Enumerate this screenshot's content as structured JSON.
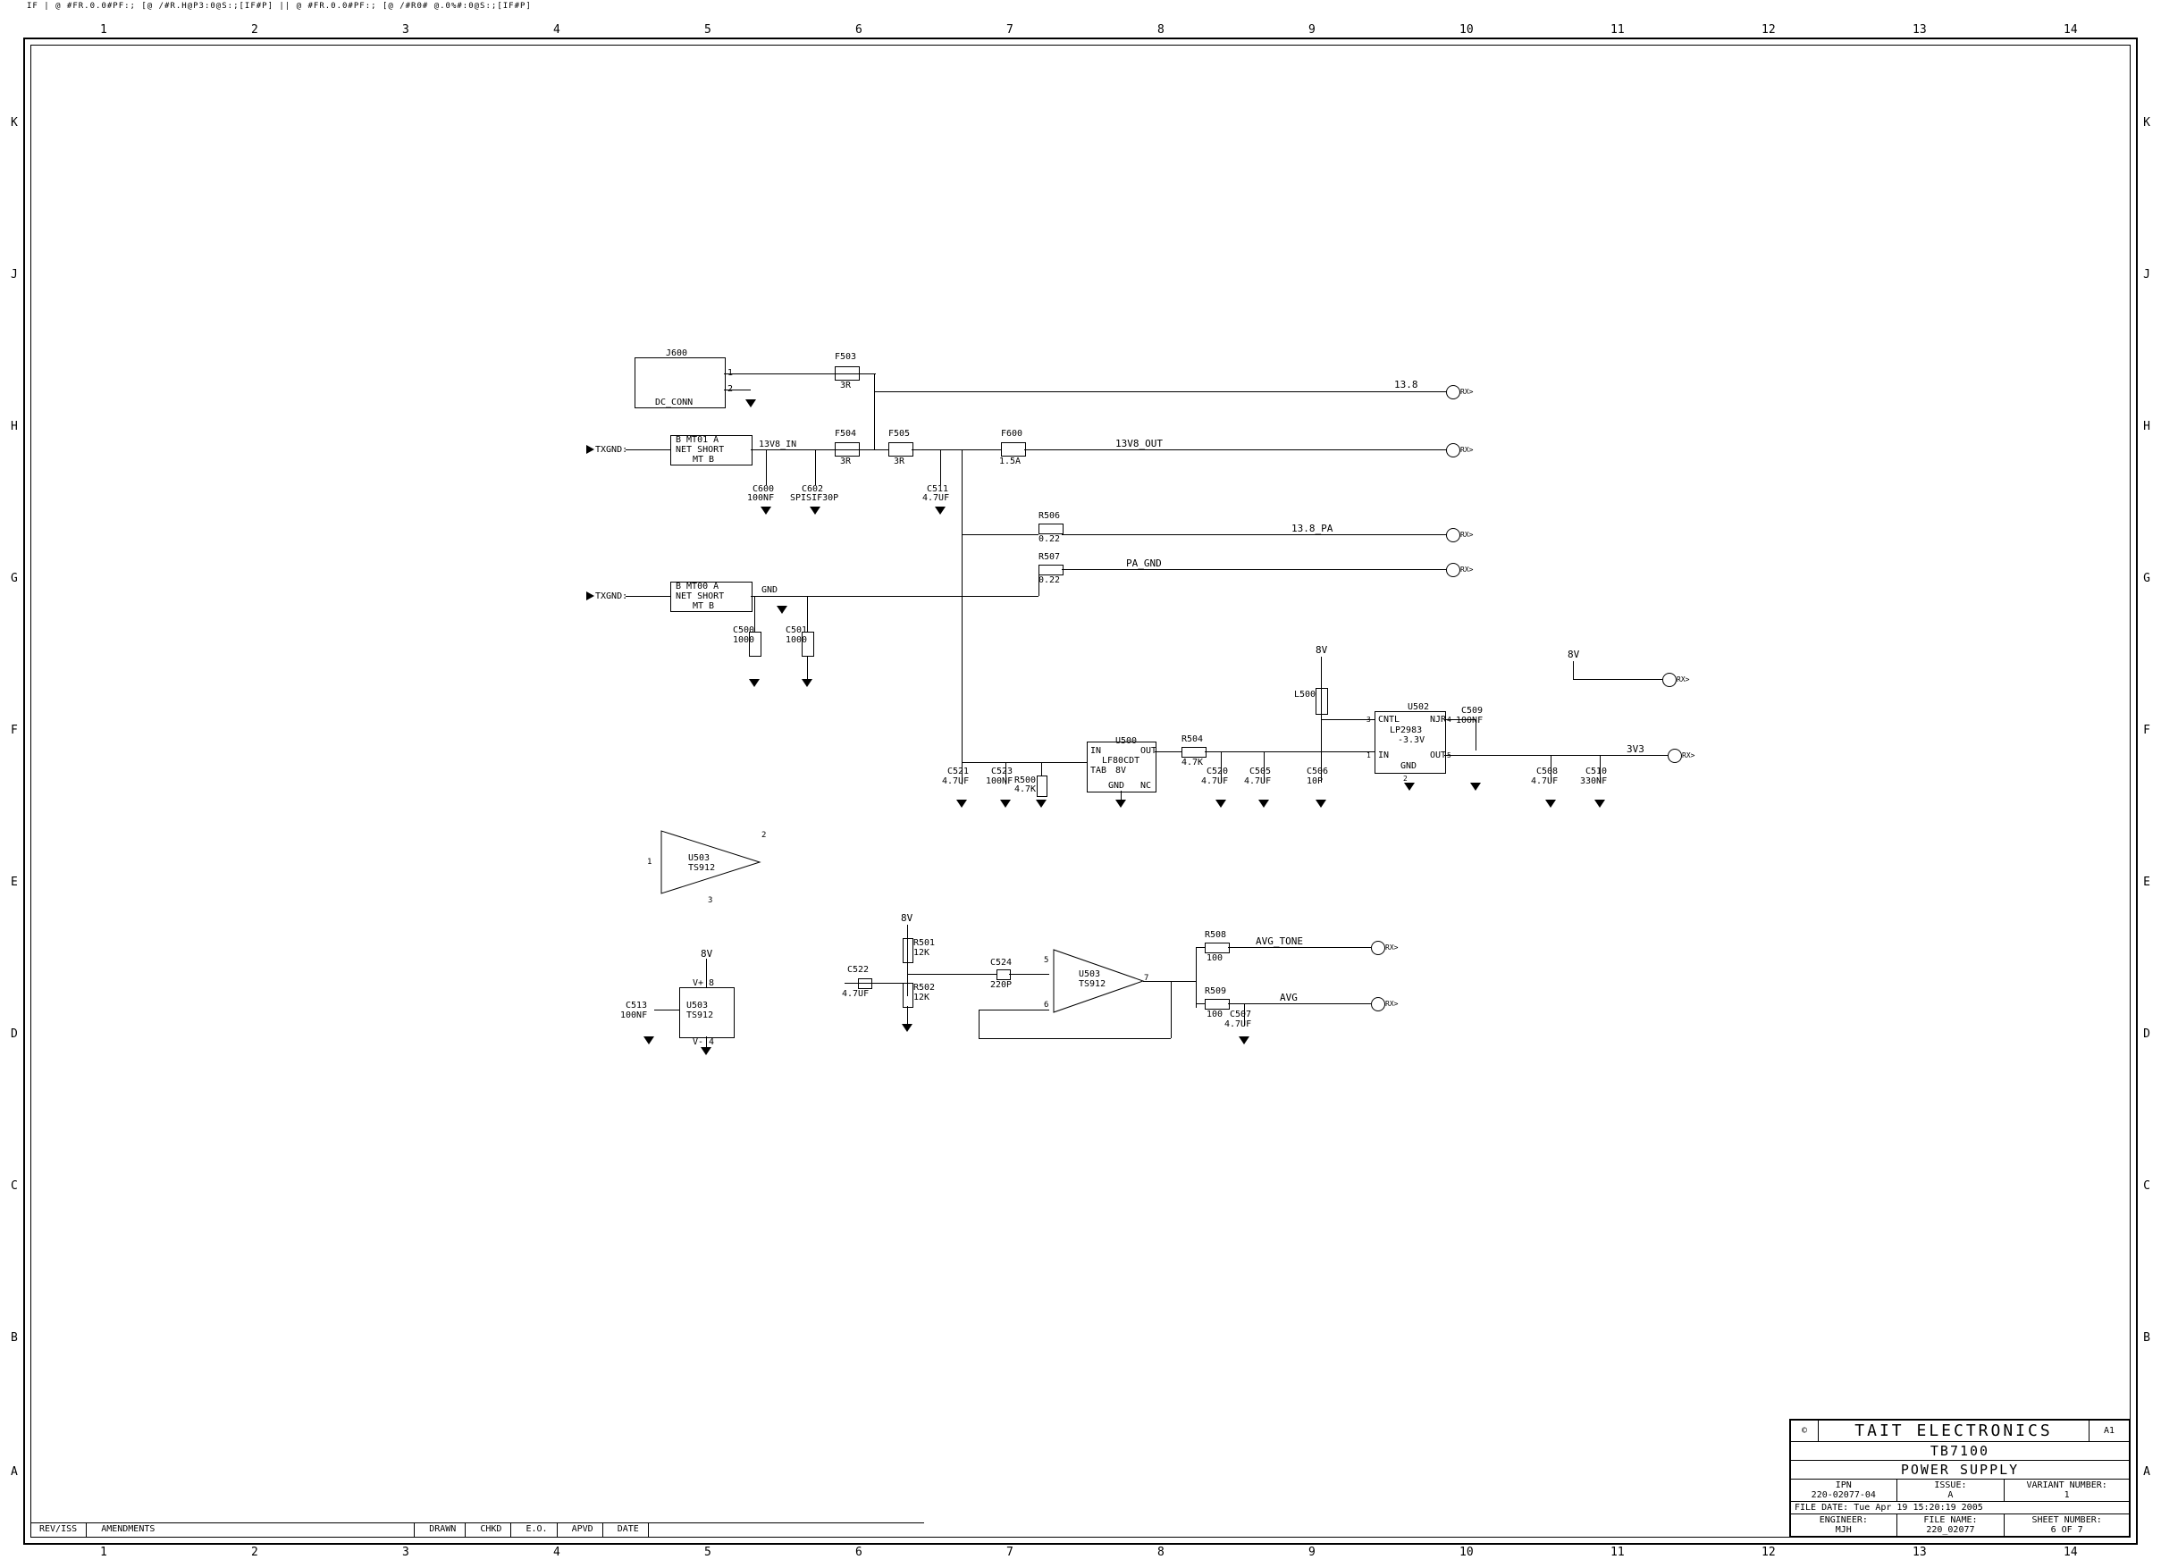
{
  "header_note": "IF | @ #FR.0.0#PF:; [@ /#R.H@P3:0@S:;[IF#P] || @ #FR.0.0#PF:; [@ /#R0# @.0%#:0@S:;[IF#P]",
  "grid": {
    "cols": [
      "1",
      "2",
      "3",
      "4",
      "5",
      "6",
      "7",
      "8",
      "9",
      "10",
      "11",
      "12",
      "13",
      "14"
    ],
    "rows": [
      "K",
      "J",
      "H",
      "G",
      "F",
      "E",
      "D",
      "C",
      "B",
      "A"
    ]
  },
  "title_block": {
    "copyright": "©",
    "company": "TAIT ELECTRONICS",
    "size": "A1",
    "model": "TB7100",
    "title": "POWER SUPPLY",
    "ipn_label": "IPN",
    "ipn": "220-02077-04",
    "issue_label": "ISSUE:",
    "issue": "A",
    "variant_label": "VARIANT NUMBER:",
    "variant": "1",
    "file_date_label": "FILE DATE:",
    "file_date": "Tue Apr 19 15:20:19 2005",
    "engineer_label": "ENGINEER:",
    "engineer": "MJH",
    "file_name_label": "FILE NAME:",
    "file_name": "220_02077",
    "sheet_label": "SHEET NUMBER:",
    "sheet": "6 OF 7"
  },
  "rev_block": {
    "rev_iss": "REV/ISS",
    "amendments": "AMENDMENTS",
    "drawn": "DRAWN",
    "chkd": "CHKD",
    "eo": "E.O.",
    "apvd": "APVD",
    "date": "DATE"
  },
  "jack": {
    "ref": "J600",
    "val": "DC_CONN"
  },
  "mt1": {
    "hdr": "B MT01 A",
    "type": "NET SHORT",
    "sub": "MT B"
  },
  "mt2": {
    "hdr": "B MT00 A",
    "type": "NET SHORT",
    "sub": "MT B"
  },
  "fuses": {
    "f503": {
      "ref": "F503",
      "val": "3R"
    },
    "f504": {
      "ref": "F504",
      "val": "3R"
    },
    "f505": {
      "ref": "F505",
      "val": "3R"
    },
    "f600": {
      "ref": "F600",
      "val": "1.5A"
    }
  },
  "caps": {
    "c600": {
      "ref": "C600",
      "val": "100NF"
    },
    "c602": {
      "ref": "C602",
      "val": "SPISIF30P"
    },
    "c511": {
      "ref": "C511",
      "val": "4.7UF"
    },
    "c500": {
      "ref": "C500",
      "val": "1000"
    },
    "c501": {
      "ref": "C501",
      "val": "1000"
    },
    "c521": {
      "ref": "C521",
      "val": "4.7UF"
    },
    "c523": {
      "ref": "C523",
      "val": "100NF"
    },
    "c520": {
      "ref": "C520",
      "val": "4.7UF"
    },
    "c505": {
      "ref": "C505",
      "val": "4.7UF"
    },
    "c506": {
      "ref": "C506",
      "val": "10P"
    },
    "c509": {
      "ref": "C509",
      "val": "100NF"
    },
    "c508": {
      "ref": "C508",
      "val": "4.7UF"
    },
    "c510": {
      "ref": "C510",
      "val": "330NF"
    },
    "c513": {
      "ref": "C513",
      "val": "100NF"
    },
    "c522": {
      "ref": "C522",
      "val": "4.7UF"
    },
    "c524": {
      "ref": "C524",
      "val": "220P"
    },
    "c507": {
      "ref": "C507",
      "val": "4.7UF"
    }
  },
  "res": {
    "r506": {
      "ref": "R506",
      "val": "0.22"
    },
    "r507": {
      "ref": "R507",
      "val": "0.22"
    },
    "r500": {
      "ref": "R500",
      "val": "4.7K"
    },
    "r504": {
      "ref": "R504",
      "val": "4.7K"
    },
    "r501": {
      "ref": "R501",
      "val": "12K"
    },
    "r502": {
      "ref": "R502",
      "val": "12K"
    },
    "r508": {
      "ref": "R508",
      "val": "100"
    },
    "r509": {
      "ref": "R509",
      "val": "100"
    }
  },
  "ics": {
    "u500": {
      "ref": "U500",
      "type": "LF80CDT",
      "sub": "8V",
      "p1": "IN",
      "p2": "OUT",
      "p3": "TAB",
      "p4": "GND",
      "p5": "NC"
    },
    "u502": {
      "ref": "U502",
      "type": "LP2983",
      "sub": "-3.3V",
      "p1": "CNTL",
      "p2": "NJR",
      "p3": "IN",
      "p4": "OUT",
      "p5": "GND"
    },
    "u503a": {
      "ref": "U503",
      "type": "TS912",
      "p1": "1",
      "p2": "2",
      "p3": "3"
    },
    "u503p": {
      "ref": "U503",
      "type": "TS912",
      "vp": "V+ 8",
      "vm": "V- 4"
    },
    "u503b": {
      "ref": "U503",
      "type": "TS912",
      "p1": "5",
      "p2": "6",
      "p3": "7"
    }
  },
  "ind": {
    "l500": {
      "ref": "L500",
      "val": "---"
    }
  },
  "nets": {
    "txgnd": "TXGND:",
    "txgnd2": "TXGND:",
    "n13v8_in": "13V8_IN",
    "n13v8": "13.8",
    "n13v8_out": "13V8_OUT",
    "n13v8_pa": "13.8_PA",
    "pa_gnd": "PA_GND",
    "n8v": "8V",
    "n8v2": "8V",
    "n3v3": "3V3",
    "gnd": "GND",
    "avg_tone": "AVG_TONE",
    "avg": "AVG"
  },
  "conn_suffix": "RX>",
  "pins": {
    "p1": "1",
    "p2": "2",
    "p3": "3",
    "p4": "4",
    "p5": "5",
    "p6": "6",
    "p7": "7",
    "p8": "8"
  }
}
